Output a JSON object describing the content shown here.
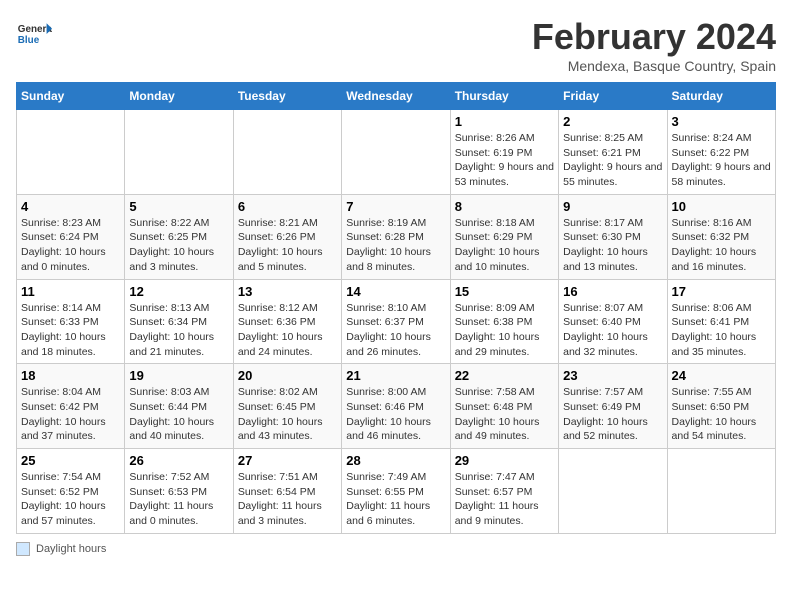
{
  "logo": {
    "general": "General",
    "blue": "Blue"
  },
  "title": "February 2024",
  "subtitle": "Mendexa, Basque Country, Spain",
  "days_header": [
    "Sunday",
    "Monday",
    "Tuesday",
    "Wednesday",
    "Thursday",
    "Friday",
    "Saturday"
  ],
  "footer_label": "Daylight hours",
  "weeks": [
    [
      {
        "num": "",
        "info": ""
      },
      {
        "num": "",
        "info": ""
      },
      {
        "num": "",
        "info": ""
      },
      {
        "num": "",
        "info": ""
      },
      {
        "num": "1",
        "info": "Sunrise: 8:26 AM\nSunset: 6:19 PM\nDaylight: 9 hours and 53 minutes."
      },
      {
        "num": "2",
        "info": "Sunrise: 8:25 AM\nSunset: 6:21 PM\nDaylight: 9 hours and 55 minutes."
      },
      {
        "num": "3",
        "info": "Sunrise: 8:24 AM\nSunset: 6:22 PM\nDaylight: 9 hours and 58 minutes."
      }
    ],
    [
      {
        "num": "4",
        "info": "Sunrise: 8:23 AM\nSunset: 6:24 PM\nDaylight: 10 hours and 0 minutes."
      },
      {
        "num": "5",
        "info": "Sunrise: 8:22 AM\nSunset: 6:25 PM\nDaylight: 10 hours and 3 minutes."
      },
      {
        "num": "6",
        "info": "Sunrise: 8:21 AM\nSunset: 6:26 PM\nDaylight: 10 hours and 5 minutes."
      },
      {
        "num": "7",
        "info": "Sunrise: 8:19 AM\nSunset: 6:28 PM\nDaylight: 10 hours and 8 minutes."
      },
      {
        "num": "8",
        "info": "Sunrise: 8:18 AM\nSunset: 6:29 PM\nDaylight: 10 hours and 10 minutes."
      },
      {
        "num": "9",
        "info": "Sunrise: 8:17 AM\nSunset: 6:30 PM\nDaylight: 10 hours and 13 minutes."
      },
      {
        "num": "10",
        "info": "Sunrise: 8:16 AM\nSunset: 6:32 PM\nDaylight: 10 hours and 16 minutes."
      }
    ],
    [
      {
        "num": "11",
        "info": "Sunrise: 8:14 AM\nSunset: 6:33 PM\nDaylight: 10 hours and 18 minutes."
      },
      {
        "num": "12",
        "info": "Sunrise: 8:13 AM\nSunset: 6:34 PM\nDaylight: 10 hours and 21 minutes."
      },
      {
        "num": "13",
        "info": "Sunrise: 8:12 AM\nSunset: 6:36 PM\nDaylight: 10 hours and 24 minutes."
      },
      {
        "num": "14",
        "info": "Sunrise: 8:10 AM\nSunset: 6:37 PM\nDaylight: 10 hours and 26 minutes."
      },
      {
        "num": "15",
        "info": "Sunrise: 8:09 AM\nSunset: 6:38 PM\nDaylight: 10 hours and 29 minutes."
      },
      {
        "num": "16",
        "info": "Sunrise: 8:07 AM\nSunset: 6:40 PM\nDaylight: 10 hours and 32 minutes."
      },
      {
        "num": "17",
        "info": "Sunrise: 8:06 AM\nSunset: 6:41 PM\nDaylight: 10 hours and 35 minutes."
      }
    ],
    [
      {
        "num": "18",
        "info": "Sunrise: 8:04 AM\nSunset: 6:42 PM\nDaylight: 10 hours and 37 minutes."
      },
      {
        "num": "19",
        "info": "Sunrise: 8:03 AM\nSunset: 6:44 PM\nDaylight: 10 hours and 40 minutes."
      },
      {
        "num": "20",
        "info": "Sunrise: 8:02 AM\nSunset: 6:45 PM\nDaylight: 10 hours and 43 minutes."
      },
      {
        "num": "21",
        "info": "Sunrise: 8:00 AM\nSunset: 6:46 PM\nDaylight: 10 hours and 46 minutes."
      },
      {
        "num": "22",
        "info": "Sunrise: 7:58 AM\nSunset: 6:48 PM\nDaylight: 10 hours and 49 minutes."
      },
      {
        "num": "23",
        "info": "Sunrise: 7:57 AM\nSunset: 6:49 PM\nDaylight: 10 hours and 52 minutes."
      },
      {
        "num": "24",
        "info": "Sunrise: 7:55 AM\nSunset: 6:50 PM\nDaylight: 10 hours and 54 minutes."
      }
    ],
    [
      {
        "num": "25",
        "info": "Sunrise: 7:54 AM\nSunset: 6:52 PM\nDaylight: 10 hours and 57 minutes."
      },
      {
        "num": "26",
        "info": "Sunrise: 7:52 AM\nSunset: 6:53 PM\nDaylight: 11 hours and 0 minutes."
      },
      {
        "num": "27",
        "info": "Sunrise: 7:51 AM\nSunset: 6:54 PM\nDaylight: 11 hours and 3 minutes."
      },
      {
        "num": "28",
        "info": "Sunrise: 7:49 AM\nSunset: 6:55 PM\nDaylight: 11 hours and 6 minutes."
      },
      {
        "num": "29",
        "info": "Sunrise: 7:47 AM\nSunset: 6:57 PM\nDaylight: 11 hours and 9 minutes."
      },
      {
        "num": "",
        "info": ""
      },
      {
        "num": "",
        "info": ""
      }
    ]
  ]
}
